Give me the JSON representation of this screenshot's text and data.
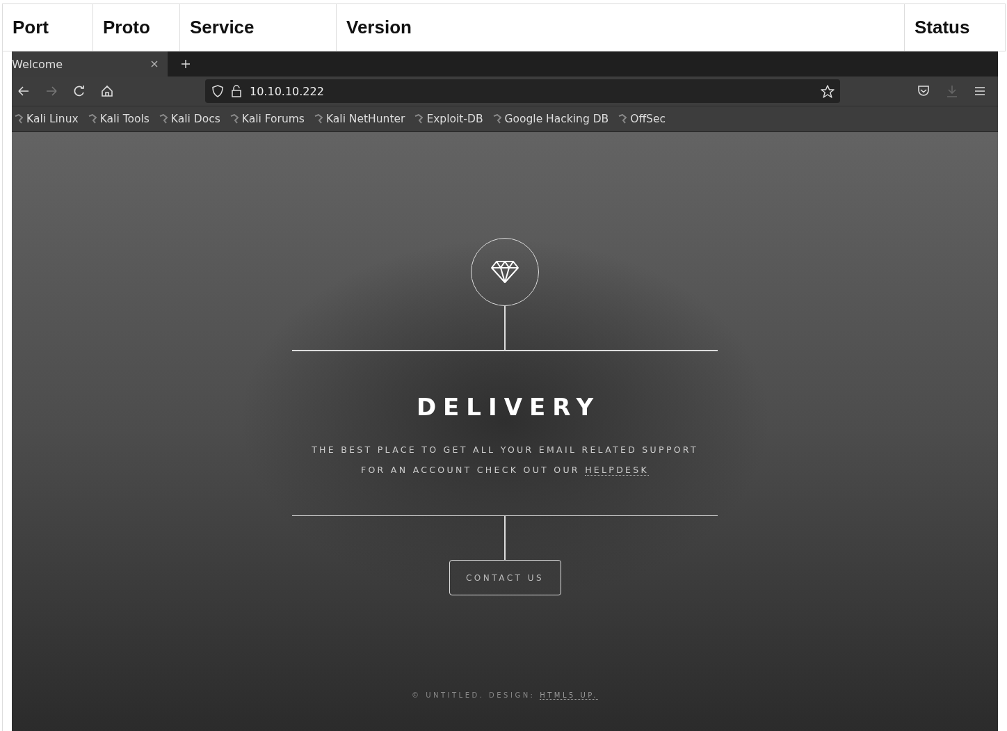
{
  "table": {
    "columns": [
      "Port",
      "Proto",
      "Service",
      "Version",
      "Status"
    ]
  },
  "browser": {
    "tabs": [
      {
        "title": "Welcome",
        "selected": true
      }
    ],
    "address": "10.10.10.222",
    "bookmarks": [
      "Kali Linux",
      "Kali Tools",
      "Kali Docs",
      "Kali Forums",
      "Kali NetHunter",
      "Exploit-DB",
      "Google Hacking DB",
      "OffSec"
    ]
  },
  "page": {
    "title": "DELIVERY",
    "lines": [
      "THE BEST PLACE TO GET ALL YOUR EMAIL RELATED SUPPORT",
      "FOR AN ACCOUNT CHECK OUT OUR"
    ],
    "helpdesk_link": "HELPDESK",
    "button": "CONTACT US",
    "footer": "© UNTITLED. DESIGN:",
    "footer_link": "HTML5 UP."
  }
}
